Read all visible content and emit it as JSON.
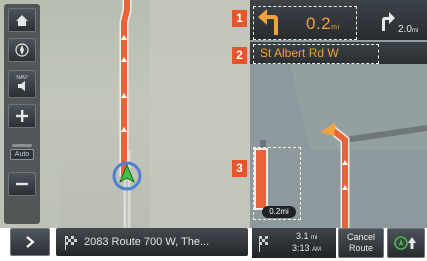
{
  "map": {
    "position_marker_icon": "navigation-arrow-icon"
  },
  "left_controls": {
    "items": [
      {
        "icon": "home-icon"
      },
      {
        "icon": "compass-icon"
      },
      {
        "icon": "speaker-icon",
        "caption": "NAVI"
      },
      {
        "icon": "zoom-in-icon"
      },
      {
        "icon": "zoom-out-icon"
      }
    ],
    "auto_label": "Auto"
  },
  "bottom_bar": {
    "expand_icon": "chevron-right-icon",
    "route_text": "2083 Route 700 W, The...",
    "route_icon": "route-flag-icon"
  },
  "guidance": {
    "turn_icon": "turn-left-arrow-icon",
    "distance_value": "0.2",
    "distance_unit": "mi",
    "next_turn_icon": "turn-right-arrow-icon",
    "next_distance_value": "2.0",
    "next_distance_unit": "mi",
    "street_name": "St Albert Rd W",
    "gauge_distance": "0.2mi"
  },
  "trip": {
    "remaining_distance_value": "3.1",
    "remaining_distance_unit": "mi",
    "eta_value": "3:13",
    "eta_unit": "AM",
    "cancel_label_line1": "Cancel",
    "cancel_label_line2": "Route",
    "compass_icon": "north-up-compass-icon"
  },
  "annotations": {
    "badge_1": "1",
    "badge_2": "2",
    "badge_3": "3"
  },
  "colors": {
    "route": "#e8623a",
    "accent_orange": "#f2a23a",
    "badge": "#e8542c"
  }
}
